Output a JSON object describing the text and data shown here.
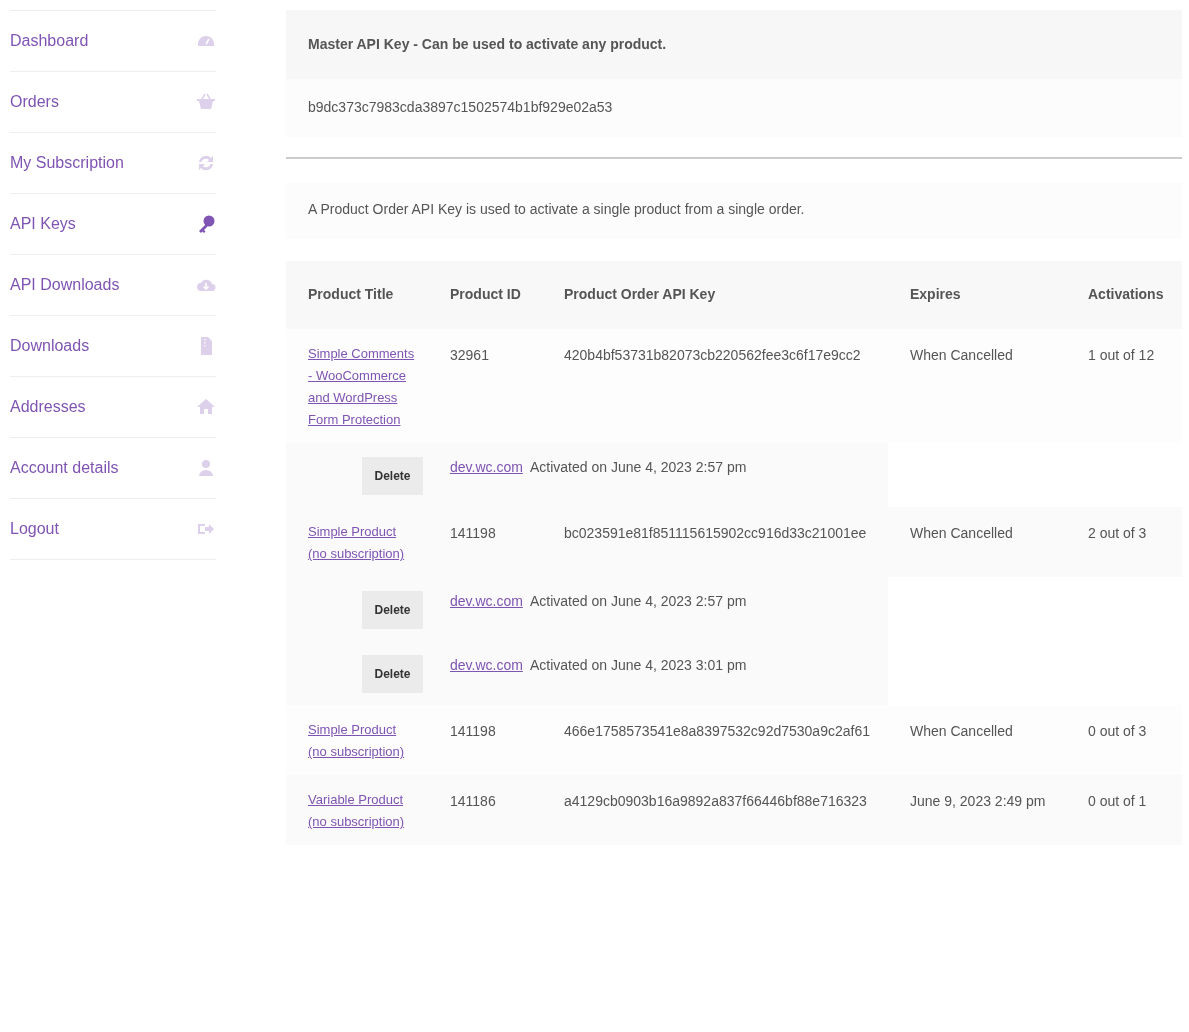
{
  "sidebar": {
    "items": [
      {
        "label": "Dashboard",
        "selected": false
      },
      {
        "label": "Orders",
        "selected": false
      },
      {
        "label": "My Subscription",
        "selected": false
      },
      {
        "label": "API Keys",
        "selected": true
      },
      {
        "label": "API Downloads",
        "selected": false
      },
      {
        "label": "Downloads",
        "selected": false
      },
      {
        "label": "Addresses",
        "selected": false
      },
      {
        "label": "Account details",
        "selected": false
      },
      {
        "label": "Logout",
        "selected": false
      }
    ]
  },
  "master_key": {
    "heading": "Master API Key - Can be used to activate any product.",
    "key": "b9dc373c7983cda3897c1502574b1bf929e02a53"
  },
  "product_key_note": "A Product Order API Key is used to activate a single product from a single order.",
  "table": {
    "columns": [
      "Product Title",
      "Product ID",
      "Product Order API Key",
      "Expires",
      "Activations"
    ],
    "rows": [
      {
        "title": "Simple Comments - WooCommerce and WordPress Form Protection",
        "id": "32961",
        "key": "420b4bf53731b82073cb220562fee3c6f17e9cc2",
        "expires": "When Cancelled",
        "activations": "1 out of 12",
        "activation_list": [
          {
            "button": "Delete",
            "domain": "dev.wc.com",
            "date": "Activated on June 4, 2023 2:57 pm"
          }
        ]
      },
      {
        "title": "Simple Product (no subscription)",
        "id": "141198",
        "key": "bc023591e81f851115615902cc916d33c21001ee",
        "expires": "When Cancelled",
        "activations": "2 out of 3",
        "activation_list": [
          {
            "button": "Delete",
            "domain": "dev.wc.com",
            "date": "Activated on June 4, 2023 2:57 pm"
          },
          {
            "button": "Delete",
            "domain": "dev.wc.com",
            "date": "Activated on June 4, 2023 3:01 pm"
          }
        ]
      },
      {
        "title": "Simple Product (no subscription)",
        "id": "141198",
        "key": "466e1758573541e8a8397532c92d7530a9c2af61",
        "expires": "When Cancelled",
        "activations": "0 out of 3"
      },
      {
        "title": "Variable Product (no subscription)",
        "id": "141186",
        "key": "a4129cb0903b16a9892a837f66446bf88e716323",
        "expires": "June 9, 2023 2:49 pm",
        "activations": "0 out of 1"
      }
    ]
  }
}
